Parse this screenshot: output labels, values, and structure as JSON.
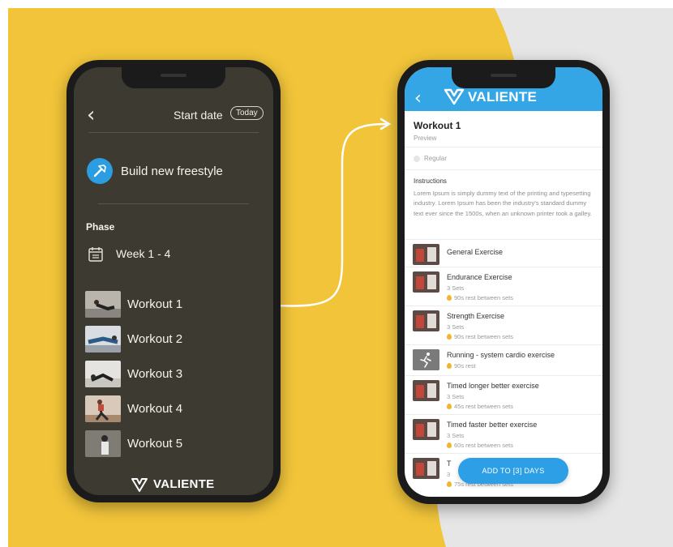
{
  "brand": {
    "name": "VALIENTE",
    "accent": "#2d9fe6",
    "background": "#f1c43a"
  },
  "left_phone": {
    "header": {
      "back_icon": "chevron-left-icon",
      "start_date": "Start date",
      "today": "Today"
    },
    "build_new": {
      "icon": "hammer-icon",
      "label": "Build new freestyle"
    },
    "phase": {
      "label": "Phase",
      "week_icon": "calendar-icon",
      "week": "Week 1 - 4"
    },
    "workouts": [
      {
        "label": "Workout 1"
      },
      {
        "label": "Workout 2"
      },
      {
        "label": "Workout 3"
      },
      {
        "label": "Workout 4"
      },
      {
        "label": "Workout 5"
      }
    ],
    "footer_brand": "VALIENTE"
  },
  "right_phone": {
    "header": {
      "back_icon": "chevron-left-icon",
      "brand": "VALIENTE"
    },
    "title": "Workout 1",
    "subtitle": "Preview",
    "level": "Regular",
    "instructions_title": "Instructions",
    "instructions_text": "Lorem Ipsum is simply dummy text of the printing and typesetting industry. Lorem Ipsum has been the industry's standard dummy text ever since the 1500s, when an unknown printer took a galley.",
    "exercises": [
      {
        "name": "General Exercise",
        "sets": "",
        "rest": ""
      },
      {
        "name": "Endurance Exercise",
        "sets": "3 Sets",
        "rest": "90s rest between sets"
      },
      {
        "name": "Strength Exercise",
        "sets": "3 Sets",
        "rest": "90s rest between sets"
      },
      {
        "name": "Running - system cardio exercise",
        "sets": "",
        "rest": "90s rest"
      },
      {
        "name": "Timed longer better exercise",
        "sets": "3 Sets",
        "rest": "45s rest between sets"
      },
      {
        "name": "Timed faster better exercise",
        "sets": "3 Sets",
        "rest": "60s rest between sets"
      },
      {
        "name": "T",
        "sets": "3",
        "rest": "75s rest between sets"
      }
    ],
    "add_button": "ADD TO [3] DAYS"
  }
}
